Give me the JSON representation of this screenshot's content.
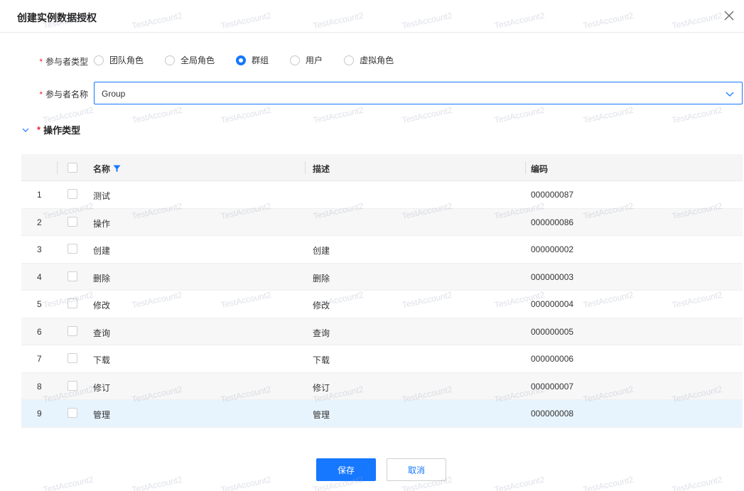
{
  "dialog": {
    "title": "创建实例数据授权",
    "close_icon": "close-icon"
  },
  "participant_type": {
    "required_mark": "*",
    "label": "参与者类型",
    "options": [
      {
        "label": "团队角色",
        "checked": false
      },
      {
        "label": "全局角色",
        "checked": false
      },
      {
        "label": "群组",
        "checked": true
      },
      {
        "label": "用户",
        "checked": false
      },
      {
        "label": "虚拟角色",
        "checked": false
      }
    ]
  },
  "participant_name": {
    "required_mark": "*",
    "label": "参与者名称",
    "value": "Group",
    "arrow_icon": "chevron-down-icon"
  },
  "operation_section": {
    "required_mark": "*",
    "title": "操作类型",
    "chevron_icon": "chevron-down-icon"
  },
  "table": {
    "columns": {
      "name": "名称",
      "description": "描述",
      "code": "编码"
    },
    "filter_icon": "filter-icon",
    "rows": [
      {
        "index": "1",
        "name": "测试",
        "description": "",
        "code": "000000087"
      },
      {
        "index": "2",
        "name": "操作",
        "description": "",
        "code": "000000086"
      },
      {
        "index": "3",
        "name": "创建",
        "description": "创建",
        "code": "000000002"
      },
      {
        "index": "4",
        "name": "删除",
        "description": "删除",
        "code": "000000003"
      },
      {
        "index": "5",
        "name": "修改",
        "description": "修改",
        "code": "000000004"
      },
      {
        "index": "6",
        "name": "查询",
        "description": "查询",
        "code": "000000005"
      },
      {
        "index": "7",
        "name": "下载",
        "description": "下载",
        "code": "000000006"
      },
      {
        "index": "8",
        "name": "修订",
        "description": "修订",
        "code": "000000007"
      },
      {
        "index": "9",
        "name": "管理",
        "description": "管理",
        "code": "000000008"
      }
    ]
  },
  "footer": {
    "save_label": "保存",
    "cancel_label": "取消"
  },
  "watermark_text": "TestAccount2",
  "colors": {
    "primary": "#1677ff",
    "required": "#f5222d",
    "selected_row": "#e8f4fd"
  }
}
